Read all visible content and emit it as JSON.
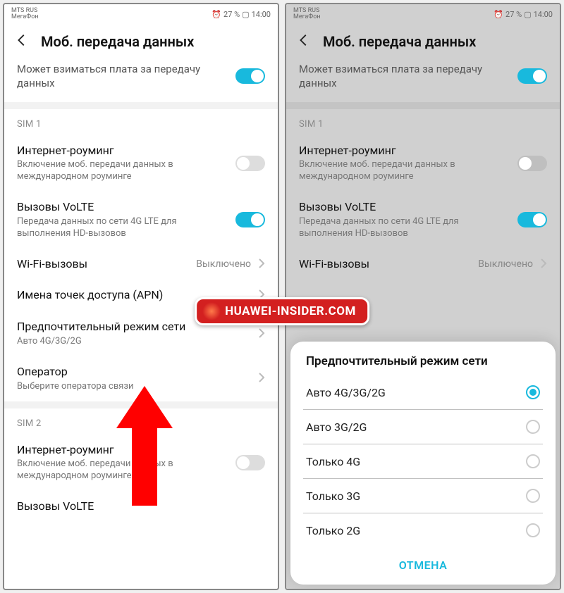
{
  "statusbar": {
    "carrier1": "MTS RUS",
    "carrier2": "МегаФон",
    "battery_pct": "27 %",
    "time": "14:00"
  },
  "header": {
    "title": "Моб. передача данных"
  },
  "topswitch": {
    "text": "Может взиматься плата за передачу данных"
  },
  "sim1": {
    "label": "SIM 1",
    "roaming": {
      "title": "Интернет-роуминг",
      "sub": "Включение моб. передачи данных в международном роуминге"
    },
    "volte": {
      "title": "Вызовы VoLTE",
      "sub": "Передача данных по сети 4G LTE для выполнения HD-вызовов"
    },
    "wifi_call": {
      "title": "Wi-Fi-вызовы",
      "value": "Выключено"
    },
    "apn": {
      "title": "Имена точек доступа (APN)"
    },
    "netmode": {
      "title": "Предпочтительный режим сети",
      "sub": "Авто 4G/3G/2G"
    },
    "operator": {
      "title": "Оператор",
      "sub": "Выберите оператора связи"
    }
  },
  "sim2": {
    "label": "SIM 2",
    "roaming": {
      "title": "Интернет-роуминг",
      "sub": "Включение моб. передачи данных в международном роуминге"
    },
    "volte": {
      "title": "Вызовы VoLTE"
    }
  },
  "right": {
    "wifi_call": {
      "title": "Wi-Fi-вызовы",
      "value": "Выключено"
    },
    "volte_bottom": "Вызовы VoLTE"
  },
  "dialog": {
    "title": "Предпочтительный режим сети",
    "options": [
      {
        "label": "Авто 4G/3G/2G",
        "checked": true
      },
      {
        "label": "Авто 3G/2G",
        "checked": false
      },
      {
        "label": "Только 4G",
        "checked": false
      },
      {
        "label": "Только 3G",
        "checked": false
      },
      {
        "label": "Только 2G",
        "checked": false
      }
    ],
    "cancel": "ОТМЕНА"
  },
  "watermark": "HUAWEI-INSIDER.COM"
}
